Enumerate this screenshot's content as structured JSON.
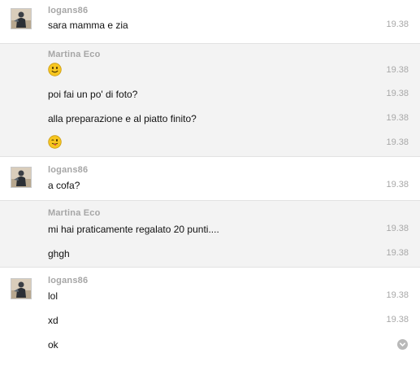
{
  "conversation": {
    "groups": [
      {
        "sender": "logans86",
        "messages": [
          {
            "text": "sara mamma e zia",
            "time": "19.38"
          }
        ]
      },
      {
        "sender": "Martina Eco",
        "messages": [
          {
            "emoji": "smiley-emoji-icon",
            "time": "19.38"
          },
          {
            "text": "poi fai un po' di foto?",
            "time": "19.38"
          },
          {
            "text": "alla preparazione e al piatto finito?",
            "time": "19.38"
          },
          {
            "emoji": "tongue-emoji-icon",
            "time": "19.38"
          }
        ]
      },
      {
        "sender": "logans86",
        "messages": [
          {
            "text": "a cofa?",
            "time": "19.38"
          }
        ]
      },
      {
        "sender": "Martina Eco",
        "messages": [
          {
            "text": "mi hai praticamente regalato 20 punti....",
            "time": "19.38"
          },
          {
            "text": "ghgh",
            "time": "19.38"
          }
        ]
      },
      {
        "sender": "logans86",
        "messages": [
          {
            "text": "lol",
            "time": "19.38"
          },
          {
            "text": "xd",
            "time": "19.38"
          },
          {
            "text": "ok",
            "status_icon": "chevron-down-icon"
          }
        ]
      }
    ]
  }
}
